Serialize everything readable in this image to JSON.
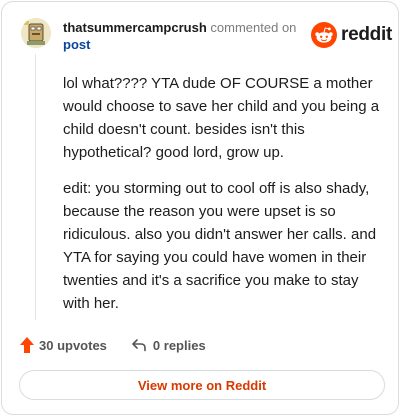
{
  "comment": {
    "username": "thatsummercampcrush",
    "action": "commented on",
    "post_link": "post",
    "paragraphs": [
      "lol what???? YTA dude OF COURSE a mother would choose to save her child and you being a child doesn't count. besides isn't this hypothetical? good lord, grow up.",
      "edit: you storming out to cool off is also shady, because the reason you were upset is so ridiculous. also you didn't answer her calls. and YTA for saying you could have women in their twenties and it's a sacrifice you make to stay with her."
    ]
  },
  "brand": {
    "wordmark": "reddit",
    "color": "#ff4500"
  },
  "footer": {
    "upvotes": "30 upvotes",
    "replies": "0 replies"
  },
  "view_more": {
    "label": "View more on Reddit"
  },
  "colors": {
    "accent": "#d93900",
    "upvote": "#ff4500",
    "link": "#0a449b"
  }
}
